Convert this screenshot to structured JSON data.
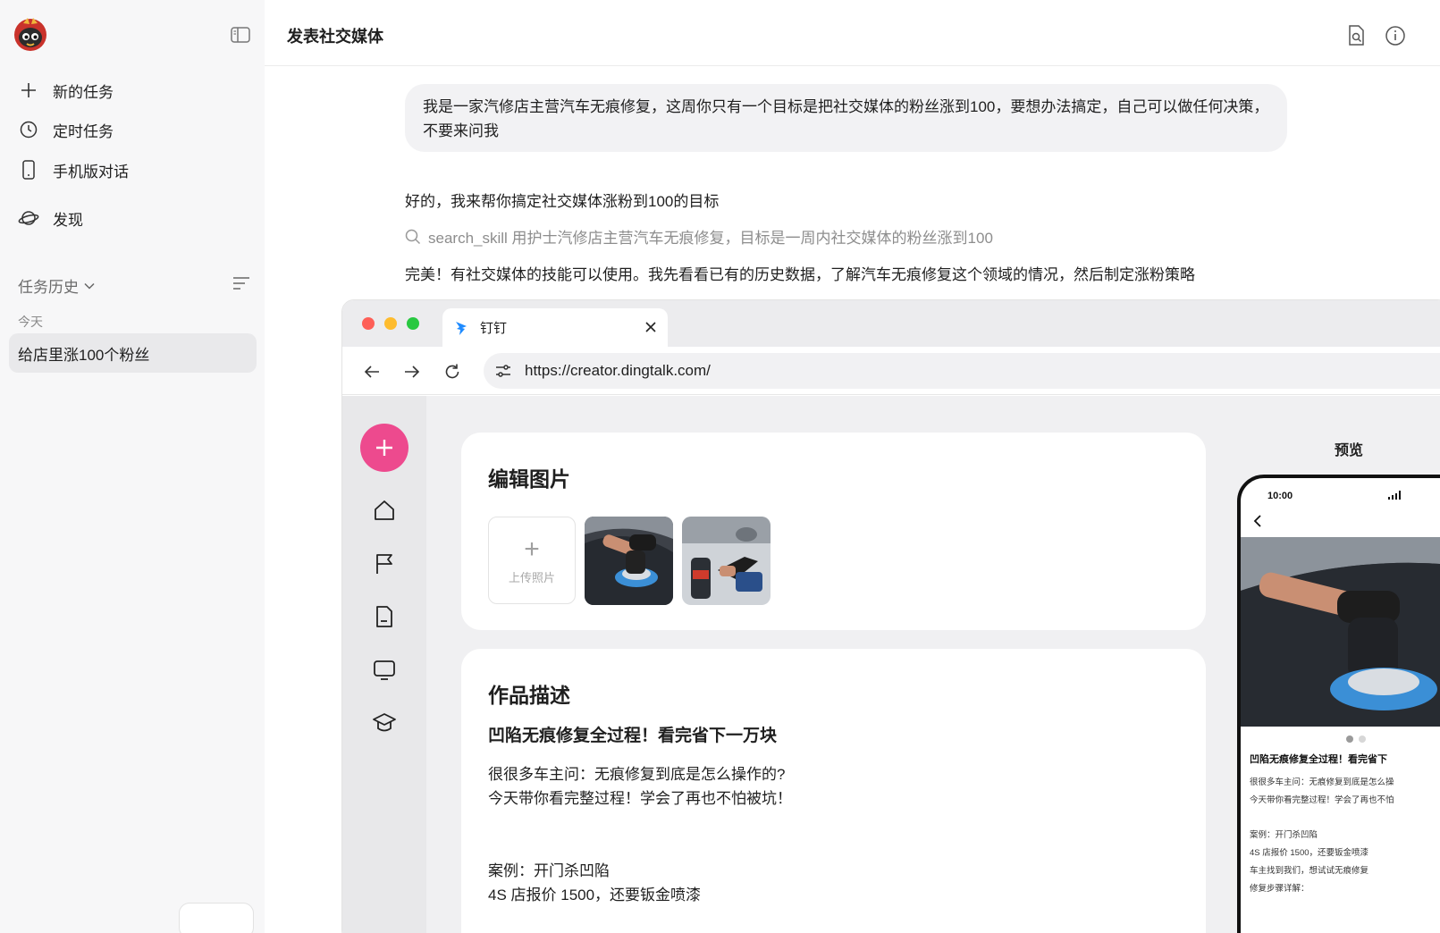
{
  "sidebar": {
    "nav": [
      {
        "label": "新的任务",
        "icon": "plus-icon"
      },
      {
        "label": "定时任务",
        "icon": "clock-icon"
      },
      {
        "label": "手机版对话",
        "icon": "phone-icon"
      },
      {
        "label": "发现",
        "icon": "planet-icon"
      }
    ],
    "history_title": "任务历史",
    "today_label": "今天",
    "history_items": [
      "给店里涨100个粉丝"
    ]
  },
  "main": {
    "title": "发表社交媒体",
    "user_message": "我是一家汽修店主营汽车无痕修复，这周你只有一个目标是把社交媒体的粉丝涨到100，要想办法搞定，自己可以做任何决策，不要来问我",
    "reply1": "好的，我来帮你搞定社交媒体涨粉到100的目标",
    "tool_call": "search_skill 用护士汽修店主营汽车无痕修复，目标是一周内社交媒体的粉丝涨到100",
    "reply2": "完美！有社交媒体的技能可以使用。我先看看已有的历史数据，了解汽车无痕修复这个领域的情况，然后制定涨粉策略"
  },
  "browser": {
    "tab_title": "钉钉",
    "url": "https://creator.dingtalk.com/",
    "edit_card_title": "编辑图片",
    "upload_label": "上传照片",
    "desc_card_title": "作品描述",
    "post_headline": "凹陷无痕修复全过程！看完省下一万块",
    "desc_lines": [
      "很很多车主问：无痕修复到底是怎么操作的?",
      "今天带你看完整过程！学会了再也不怕被坑！",
      "案例：开门杀凹陷",
      "4S 店报价 1500，还要钣金喷漆"
    ],
    "preview_label": "预览",
    "phone": {
      "time": "10:00",
      "headline": "凹陷无痕修复全过程！看完省下",
      "lines": [
        "很很多车主问：无痕修复到底是怎么操",
        "今天带你看完整过程！学会了再也不怕",
        "案例：开门杀凹陷",
        "4S 店报价 1500，还要钣金喷漆",
        "车主找到我们，想试试无痕修复",
        "修复步骤详解："
      ]
    }
  },
  "colors": {
    "sidebar_bg": "#f7f7f8",
    "accent_pink": "#ed4a8e",
    "dingtalk_blue": "#1f8bff",
    "traffic_red": "#fe5f57",
    "traffic_yellow": "#febc2e",
    "traffic_green": "#28c840"
  }
}
